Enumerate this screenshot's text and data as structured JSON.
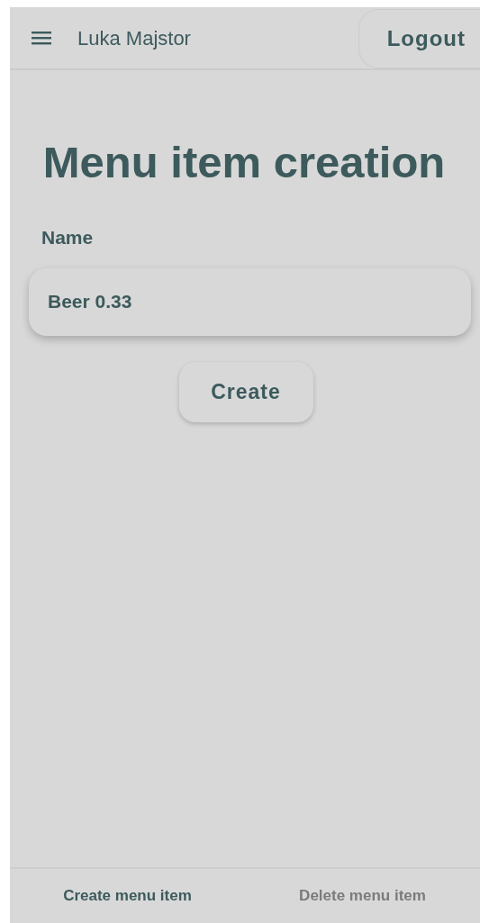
{
  "header": {
    "user_name": "Luka Majstor",
    "logout_button": "Logout"
  },
  "title": "Menu item creation",
  "form": {
    "name_label": "Name",
    "name_value": "Beer 0.33",
    "submit_button": "Create"
  },
  "bottom_tabs": [
    {
      "label": "Create menu item",
      "selected": true
    },
    {
      "label": "Delete menu item",
      "selected": false
    }
  ]
}
